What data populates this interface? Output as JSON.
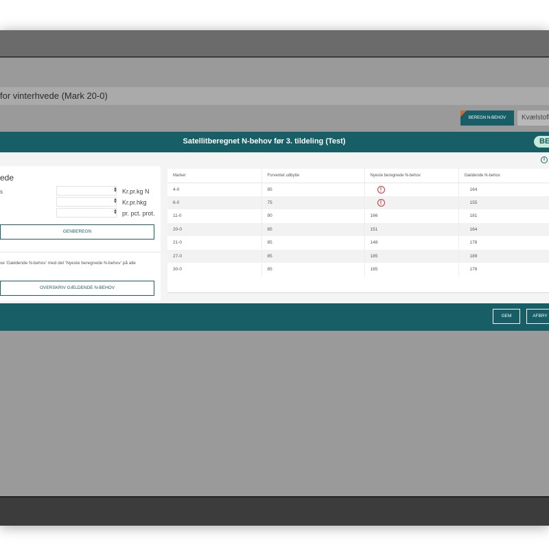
{
  "page": {
    "title": "for vinterhvede (Mark 20-0)",
    "beregn_button": "BEREGN N-BEHOV",
    "kvaelstof_button": "Kvælstofb"
  },
  "modal": {
    "title": "Satellitberegnet N-behov før 3. tildeling (Test)",
    "badge": "BE",
    "left": {
      "title": "ede",
      "rows": [
        {
          "label": "s",
          "value": "",
          "unit": "Kr.pr.kg N"
        },
        {
          "label": "",
          "value": "",
          "unit": "Kr.pr.hkg"
        },
        {
          "label": "",
          "value": "",
          "unit": "pr. pct. prot."
        }
      ],
      "genberegn_button": "GENBEREGN",
      "note": "ve 'Gældende N-behov' med det 'Nyeste beregnede N-behov' på alle",
      "overskriv_button": "OVERSKRIV GÆLDENDE N-BEHOV"
    },
    "table": {
      "columns": [
        "Marker",
        "Forventet udbytte",
        "Nyeste beregnede N-behov",
        "Gældende N-behov"
      ],
      "rows": [
        {
          "marker": "4-0",
          "udbytte": "85",
          "nyeste": "",
          "alert": true,
          "gaeldende": "164"
        },
        {
          "marker": "6-0",
          "udbytte": "75",
          "nyeste": "",
          "alert": true,
          "gaeldende": "155"
        },
        {
          "marker": "11-0",
          "udbytte": "90",
          "nyeste": "166",
          "alert": false,
          "gaeldende": "181"
        },
        {
          "marker": "20-0",
          "udbytte": "85",
          "nyeste": "151",
          "alert": false,
          "gaeldende": "164"
        },
        {
          "marker": "21-0",
          "udbytte": "85",
          "nyeste": "148",
          "alert": false,
          "gaeldende": "178"
        },
        {
          "marker": "27-0",
          "udbytte": "85",
          "nyeste": "185",
          "alert": false,
          "gaeldende": "189"
        },
        {
          "marker": "30-0",
          "udbytte": "85",
          "nyeste": "185",
          "alert": false,
          "gaeldende": "178"
        }
      ]
    },
    "footer": {
      "gem_button": "GEM",
      "afbryd_button": "AFBRY"
    }
  },
  "colors": {
    "accent": "#175e66",
    "alert": "#c8323a",
    "badge": "#c8e8d8"
  },
  "icons": {
    "info": "info-icon",
    "alert": "alert-circle-icon",
    "spinner": "spinner-arrows-icon"
  }
}
